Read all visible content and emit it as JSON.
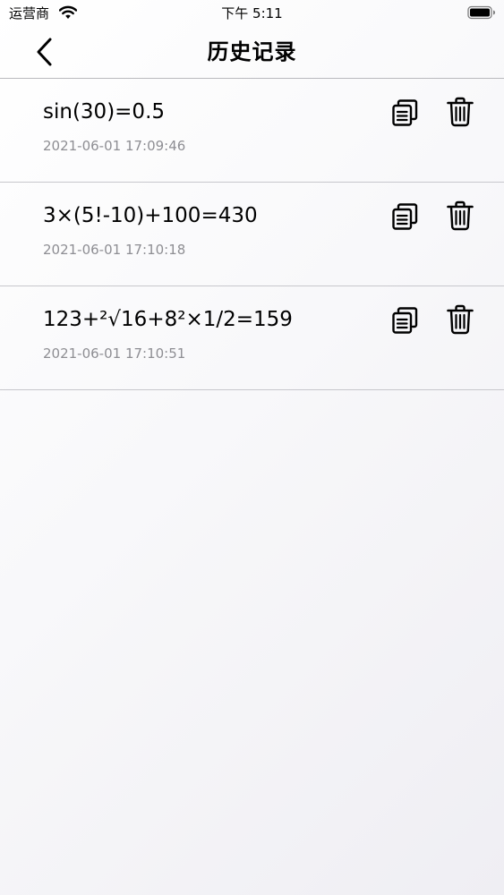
{
  "status_bar": {
    "carrier": "运营商",
    "time": "下午 5:11"
  },
  "nav": {
    "title": "历史记录"
  },
  "history": [
    {
      "expression": "sin(30)=0.5",
      "timestamp": "2021-06-01 17:09:46"
    },
    {
      "expression": "3×(5!-10)+100=430",
      "timestamp": "2021-06-01 17:10:18"
    },
    {
      "expression": "123+²√16+8²×1/2=159",
      "timestamp": "2021-06-01 17:10:51"
    }
  ],
  "icons": {
    "back": "chevron-left-icon",
    "copy": "copy-icon",
    "delete": "trash-icon",
    "wifi": "wifi-icon",
    "battery": "battery-icon"
  }
}
